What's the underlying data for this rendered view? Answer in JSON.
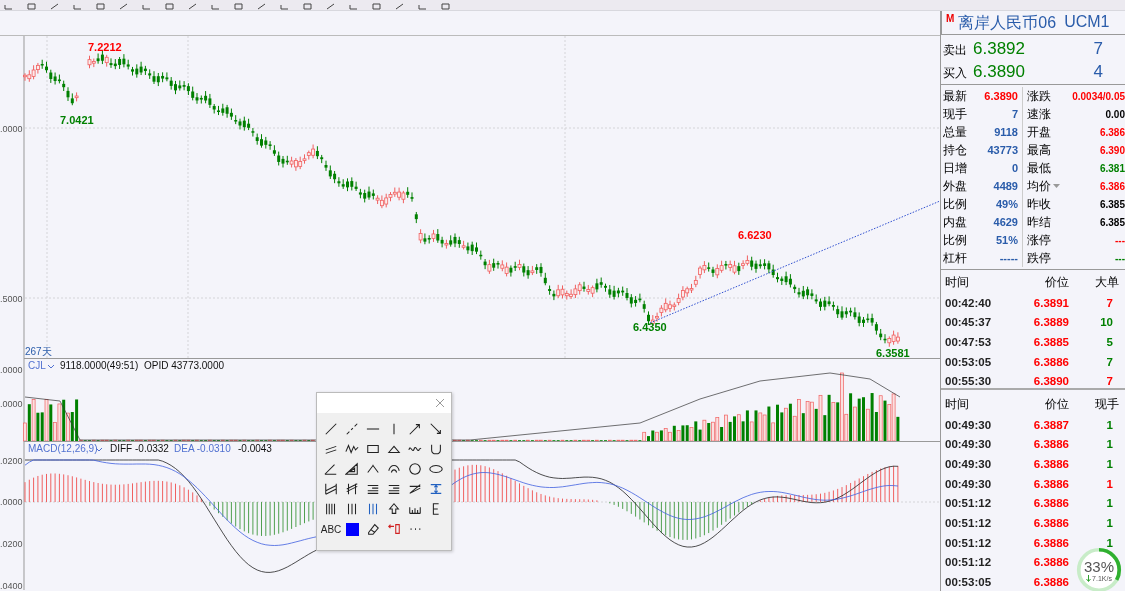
{
  "chart": {
    "axis_labels": [
      ".0000",
      ".5000"
    ],
    "price_marks": [
      {
        "text": "7.2212",
        "color": "#ff0000"
      },
      {
        "text": "7.0421",
        "color": "#008000"
      },
      {
        "text": "6.6230",
        "color": "#ff0000"
      },
      {
        "text": "6.4350",
        "color": "#008000"
      },
      {
        "text": "6.3581",
        "color": "#008000"
      }
    ],
    "period": "267天"
  },
  "volume_pane": {
    "indicator": "CJL",
    "value": "9118.0000(49:51)",
    "opid": "OPID 43773.0000",
    "axis_labels": [
      ".0000",
      ".0000"
    ]
  },
  "macd_pane": {
    "indicator": "MACD(12,26,9)",
    "diff": "DIFF -0.0332",
    "dea": "DEA -0.0310",
    "macd": "-0.0043",
    "axis_labels": [
      ".0200",
      ".0000",
      ".0200",
      ".0400"
    ]
  },
  "drawing_palette": {
    "text_tool": "ABC",
    "color": "#0000ff"
  },
  "quote": {
    "badge": "M",
    "name": "离岸人民币06",
    "code": "UCM1",
    "sell": {
      "label": "卖出",
      "price": "6.3892",
      "volume": "7"
    },
    "buy": {
      "label": "买入",
      "price": "6.3890",
      "volume": "4"
    },
    "stats": [
      {
        "left": {
          "label": "最新",
          "value": "6.3890",
          "color": "#ff0000"
        },
        "right": {
          "label": "涨跌",
          "value": "0.0034/0.05",
          "color": "#ff0000"
        },
        "kind": "plain"
      },
      {
        "left": {
          "label": "现手",
          "value": "7",
          "color": "#2a5caa"
        },
        "right": {
          "label": "速涨",
          "value": "0.00",
          "color": "#000000"
        },
        "kind": "plain"
      },
      {
        "left": {
          "label": "总量",
          "value": "9118",
          "color": "#2a5caa"
        },
        "right": {
          "label": "开盘",
          "value": "6.386",
          "color": "#ff0000"
        },
        "kind": "plain"
      },
      {
        "left": {
          "label": "持仓",
          "value": "43773",
          "color": "#2a5caa"
        },
        "right": {
          "label": "最高",
          "value": "6.390",
          "color": "#ff0000"
        },
        "kind": "plain"
      },
      {
        "left": {
          "label": "日增",
          "value": "0",
          "color": "#2a5caa"
        },
        "right": {
          "label": "最低",
          "value": "6.381",
          "color": "#008000"
        },
        "kind": "plain"
      },
      {
        "left": {
          "label": "外盘",
          "value": "4489",
          "color": "#2a5caa"
        },
        "right": {
          "label": "均价",
          "value": "6.386",
          "color": "#ff0000"
        },
        "kind": "menu"
      },
      {
        "left": {
          "label": "比例",
          "value": "49%",
          "color": "#2a5caa"
        },
        "right": {
          "label": "昨收",
          "value": "6.385",
          "color": "#000000"
        },
        "kind": "plain"
      },
      {
        "left": {
          "label": "内盘",
          "value": "4629",
          "color": "#2a5caa"
        },
        "right": {
          "label": "昨结",
          "value": "6.385",
          "color": "#000000"
        },
        "kind": "plain"
      },
      {
        "left": {
          "label": "比例",
          "value": "51%",
          "color": "#2a5caa"
        },
        "right": {
          "label": "涨停",
          "value": "---",
          "color": "#ff0000"
        },
        "kind": "plain"
      },
      {
        "left": {
          "label": "杠杆",
          "value": "-----",
          "color": "#2a5caa"
        },
        "right": {
          "label": "跌停",
          "value": "---",
          "color": "#008000"
        },
        "kind": "plain"
      }
    ]
  },
  "big_orders": {
    "columns": [
      "时间",
      "价位",
      "大单"
    ],
    "rows": [
      {
        "time": "00:42:40",
        "price": "6.3891",
        "volume": "7",
        "color": "#ff0000"
      },
      {
        "time": "00:45:37",
        "price": "6.3889",
        "volume": "10",
        "color": "#008000"
      },
      {
        "time": "00:47:53",
        "price": "6.3885",
        "volume": "5",
        "color": "#008000"
      },
      {
        "time": "00:53:05",
        "price": "6.3886",
        "volume": "7",
        "color": "#008000"
      },
      {
        "time": "00:55:30",
        "price": "6.3890",
        "volume": "7",
        "color": "#ff0000"
      }
    ]
  },
  "ticks": {
    "columns": [
      "时间",
      "价位",
      "现手"
    ],
    "rows": [
      {
        "time": "00:49:30",
        "price": "6.3887",
        "volume": "1",
        "color": "#008000"
      },
      {
        "time": "00:49:30",
        "price": "6.3886",
        "volume": "1",
        "color": "#008000"
      },
      {
        "time": "00:49:30",
        "price": "6.3886",
        "volume": "1",
        "color": "#008000"
      },
      {
        "time": "00:49:30",
        "price": "6.3886",
        "volume": "1",
        "color": "#ff0000"
      },
      {
        "time": "00:51:12",
        "price": "6.3886",
        "volume": "1",
        "color": "#008000"
      },
      {
        "time": "00:51:12",
        "price": "6.3886",
        "volume": "1",
        "color": "#008000"
      },
      {
        "time": "00:51:12",
        "price": "6.3886",
        "volume": "1",
        "color": "#008000"
      },
      {
        "time": "00:51:12",
        "price": "6.3886"
      },
      {
        "time": "00:53:05",
        "price": "6.3886"
      }
    ]
  },
  "speed_widget": {
    "percent": "33%",
    "rate": "7.1K/s"
  }
}
